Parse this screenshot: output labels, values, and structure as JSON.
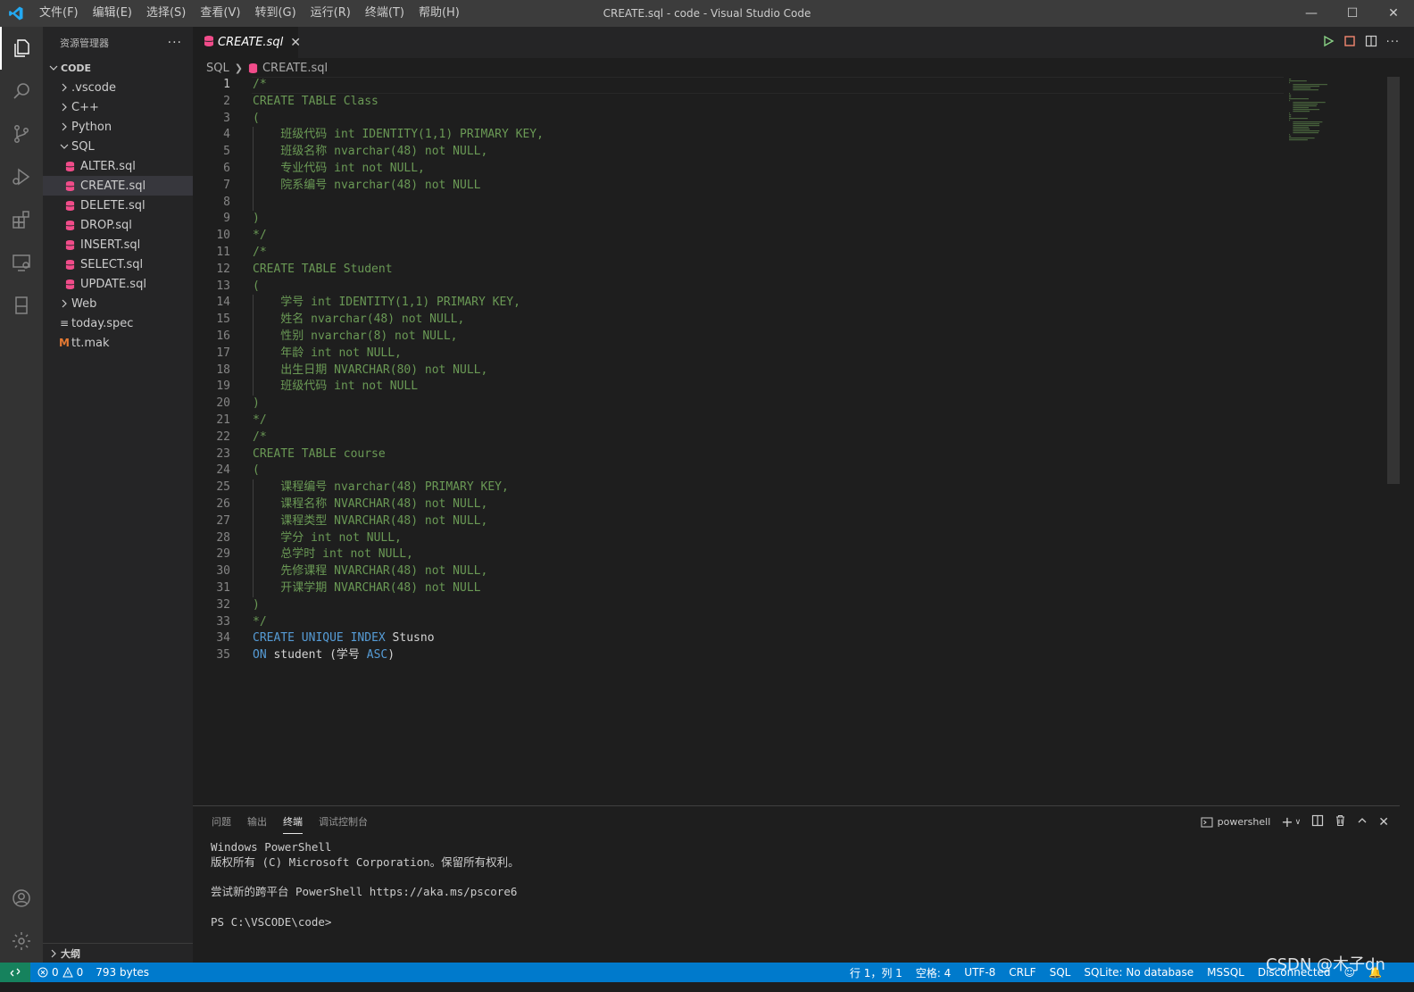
{
  "window": {
    "title": "CREATE.sql - code - Visual Studio Code",
    "menu": [
      "文件(F)",
      "编辑(E)",
      "选择(S)",
      "查看(V)",
      "转到(G)",
      "运行(R)",
      "终端(T)",
      "帮助(H)"
    ]
  },
  "sidebar": {
    "title": "资源管理器",
    "more": "···",
    "section": "CODE",
    "tree": [
      {
        "label": ".vscode",
        "type": "folder",
        "expanded": false,
        "depth": 1
      },
      {
        "label": "C++",
        "type": "folder",
        "expanded": false,
        "depth": 1
      },
      {
        "label": "Python",
        "type": "folder",
        "expanded": false,
        "depth": 1
      },
      {
        "label": "SQL",
        "type": "folder",
        "expanded": true,
        "depth": 1
      },
      {
        "label": "ALTER.sql",
        "type": "sql",
        "depth": 2
      },
      {
        "label": "CREATE.sql",
        "type": "sql",
        "depth": 2,
        "selected": true
      },
      {
        "label": "DELETE.sql",
        "type": "sql",
        "depth": 2
      },
      {
        "label": "DROP.sql",
        "type": "sql",
        "depth": 2
      },
      {
        "label": "INSERT.sql",
        "type": "sql",
        "depth": 2
      },
      {
        "label": "SELECT.sql",
        "type": "sql",
        "depth": 2
      },
      {
        "label": "UPDATE.sql",
        "type": "sql",
        "depth": 2
      },
      {
        "label": "Web",
        "type": "folder",
        "expanded": false,
        "depth": 1
      },
      {
        "label": "today.spec",
        "type": "spec",
        "depth": 1
      },
      {
        "label": "tt.mak",
        "type": "mak",
        "depth": 1
      }
    ],
    "outline": "大纲"
  },
  "editor": {
    "tab": "CREATE.sql",
    "breadcrumb": [
      "SQL",
      "CREATE.sql"
    ],
    "current_line": 1,
    "lines": [
      [
        {
          "t": "/*",
          "c": "cm"
        }
      ],
      [
        {
          "t": "CREATE TABLE Class",
          "c": "cm"
        }
      ],
      [
        {
          "t": "(",
          "c": "cm"
        }
      ],
      [
        {
          "t": "    班级代码 int IDENTITY(1,1) PRIMARY KEY,",
          "c": "cm"
        }
      ],
      [
        {
          "t": "    班级名称 nvarchar(48) not NULL,",
          "c": "cm"
        }
      ],
      [
        {
          "t": "    专业代码 int not NULL,",
          "c": "cm"
        }
      ],
      [
        {
          "t": "    院系编号 nvarchar(48) not NULL",
          "c": "cm"
        }
      ],
      [
        {
          "t": "",
          "c": "cm"
        }
      ],
      [
        {
          "t": ")",
          "c": "cm"
        }
      ],
      [
        {
          "t": "*/",
          "c": "cm"
        }
      ],
      [
        {
          "t": "/*",
          "c": "cm"
        }
      ],
      [
        {
          "t": "CREATE TABLE Student",
          "c": "cm"
        }
      ],
      [
        {
          "t": "(",
          "c": "cm"
        }
      ],
      [
        {
          "t": "    学号 int IDENTITY(1,1) PRIMARY KEY,",
          "c": "cm"
        }
      ],
      [
        {
          "t": "    姓名 nvarchar(48) not NULL,",
          "c": "cm"
        }
      ],
      [
        {
          "t": "    性别 nvarchar(8) not NULL,",
          "c": "cm"
        }
      ],
      [
        {
          "t": "    年龄 int not NULL,",
          "c": "cm"
        }
      ],
      [
        {
          "t": "    出生日期 NVARCHAR(80) not NULL,",
          "c": "cm"
        }
      ],
      [
        {
          "t": "    班级代码 int not NULL",
          "c": "cm"
        }
      ],
      [
        {
          "t": ")",
          "c": "cm"
        }
      ],
      [
        {
          "t": "*/",
          "c": "cm"
        }
      ],
      [
        {
          "t": "/*",
          "c": "cm"
        }
      ],
      [
        {
          "t": "CREATE TABLE course",
          "c": "cm"
        }
      ],
      [
        {
          "t": "(",
          "c": "cm"
        }
      ],
      [
        {
          "t": "    课程编号 nvarchar(48) PRIMARY KEY,",
          "c": "cm"
        }
      ],
      [
        {
          "t": "    课程名称 NVARCHAR(48) not NULL,",
          "c": "cm"
        }
      ],
      [
        {
          "t": "    课程类型 NVARCHAR(48) not NULL,",
          "c": "cm"
        }
      ],
      [
        {
          "t": "    学分 int not NULL,",
          "c": "cm"
        }
      ],
      [
        {
          "t": "    总学时 int not NULL,",
          "c": "cm"
        }
      ],
      [
        {
          "t": "    先修课程 NVARCHAR(48) not NULL,",
          "c": "cm"
        }
      ],
      [
        {
          "t": "    开课学期 NVARCHAR(48) not NULL",
          "c": "cm"
        }
      ],
      [
        {
          "t": ")",
          "c": "cm"
        }
      ],
      [
        {
          "t": "*/",
          "c": "cm"
        }
      ],
      [
        {
          "t": "CREATE",
          "c": "kw"
        },
        {
          "t": " ",
          "c": "pl"
        },
        {
          "t": "UNIQUE",
          "c": "kw"
        },
        {
          "t": " ",
          "c": "pl"
        },
        {
          "t": "INDEX",
          "c": "kw"
        },
        {
          "t": " Stusno",
          "c": "pl"
        }
      ],
      [
        {
          "t": "ON",
          "c": "kw"
        },
        {
          "t": " student (学号 ",
          "c": "pl"
        },
        {
          "t": "ASC",
          "c": "kw"
        },
        {
          "t": ")",
          "c": "pl"
        }
      ]
    ]
  },
  "panel": {
    "tabs": [
      "问题",
      "输出",
      "终端",
      "调试控制台"
    ],
    "active_tab": "终端",
    "shell": "powershell",
    "terminal_lines": [
      "Windows PowerShell",
      "版权所有 (C) Microsoft Corporation。保留所有权利。",
      "",
      "尝试新的跨平台 PowerShell https://aka.ms/pscore6",
      "",
      "PS C:\\VSCODE\\code>"
    ]
  },
  "status": {
    "errors": "0",
    "warnings": "0",
    "size": "793 bytes",
    "position": "行 1，列 1",
    "spaces": "空格: 4",
    "encoding": "UTF-8",
    "eol": "CRLF",
    "language": "SQL",
    "sqlite": "SQLite: No database",
    "mssql": "MSSQL",
    "connection": "Disconnected"
  },
  "watermark": "CSDN @木子dn",
  "colors": {
    "accent": "#007acc",
    "comment": "#6a9955",
    "keyword": "#569cd6",
    "sql_icon": "#f14c8a"
  }
}
